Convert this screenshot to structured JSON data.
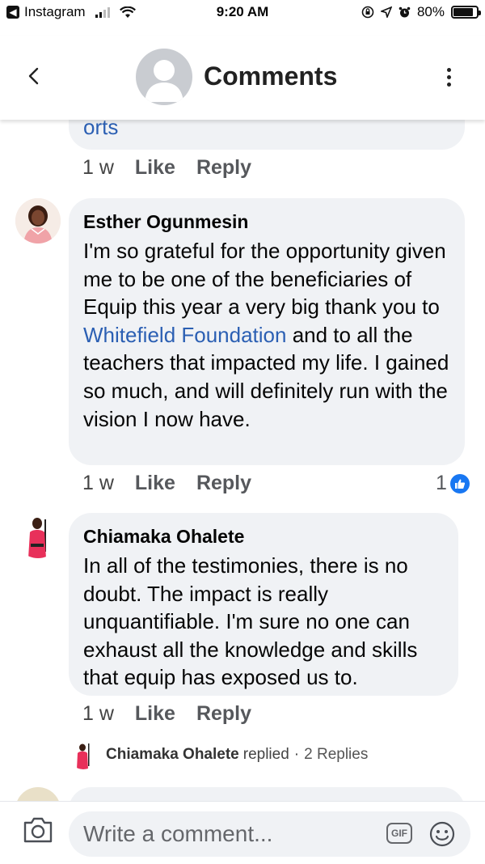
{
  "status_bar": {
    "back_app": "Instagram",
    "time": "9:20 AM",
    "battery": "80%"
  },
  "header": {
    "title": "Comments"
  },
  "partial_comment": {
    "text": "orts",
    "age": "1 w",
    "like_label": "Like",
    "reply_label": "Reply"
  },
  "comments": [
    {
      "author": "Esther Ogunmesin",
      "text_parts": [
        "I'm so grateful for the opportunity given me to be one of the beneficiaries of Equip this year a very big thank you to ",
        "Whitefield Foundation",
        " and to all the teachers that impacted my life. I gained so much, and will definitely run with the vision I now have."
      ],
      "age": "1 w",
      "like_label": "Like",
      "reply_label": "Reply",
      "reaction_count": "1"
    },
    {
      "author": "Chiamaka Ohalete",
      "text": "In all of the testimonies, there is no doubt. The impact is really unquantifiable. I'm sure no one can exhaust all the knowledge and skills that equip has exposed us to.",
      "age": "1 w",
      "like_label": "Like",
      "reply_label": "Reply",
      "replies": {
        "name": "Chiamaka Ohalete",
        "verb": "replied",
        "count": "2 Replies"
      }
    }
  ],
  "composer": {
    "placeholder": "Write a comment...",
    "gif_label": "GIF"
  },
  "colors": {
    "bubble": "#f0f2f5",
    "link": "#2b5fb3",
    "like_blue": "#1877f2"
  }
}
